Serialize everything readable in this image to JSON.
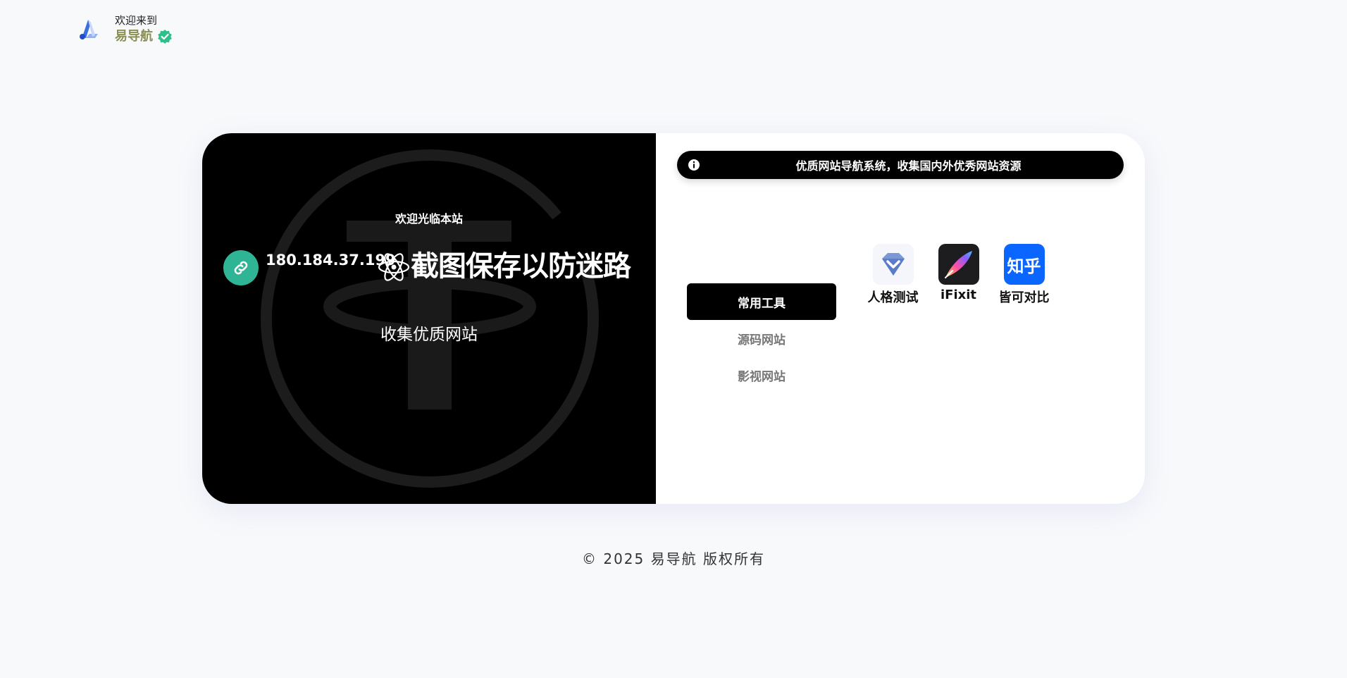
{
  "header": {
    "welcome": "欢迎来到",
    "site_name": "易导航"
  },
  "hero": {
    "greeting": "欢迎光临本站",
    "ip": "180.184.37.199",
    "headline": "截图保存以防迷路",
    "subline": "收集优质网站"
  },
  "notice": {
    "text": "优质网站导航系统，收集国内外优秀网站资源"
  },
  "tabs": [
    {
      "label": "常用工具",
      "active": true
    },
    {
      "label": "源码网站",
      "active": false
    },
    {
      "label": "影视网站",
      "active": false
    }
  ],
  "apps": [
    {
      "label": "人格测试",
      "icon": "diamond-check-icon"
    },
    {
      "label": "iFixit",
      "icon": "feather-brush-icon"
    },
    {
      "label": "皆可对比",
      "icon": "zhihu-icon",
      "icon_text": "知乎"
    }
  ],
  "footer": {
    "text": "© 2025 易导航 版权所有"
  },
  "colors": {
    "background": "#f8f9fb",
    "brand_name": "#8b8f52",
    "verified": "#2fc08a",
    "link_badge": "#2fb596",
    "zhihu_blue": "#0a66ff",
    "dark": "#000000"
  }
}
